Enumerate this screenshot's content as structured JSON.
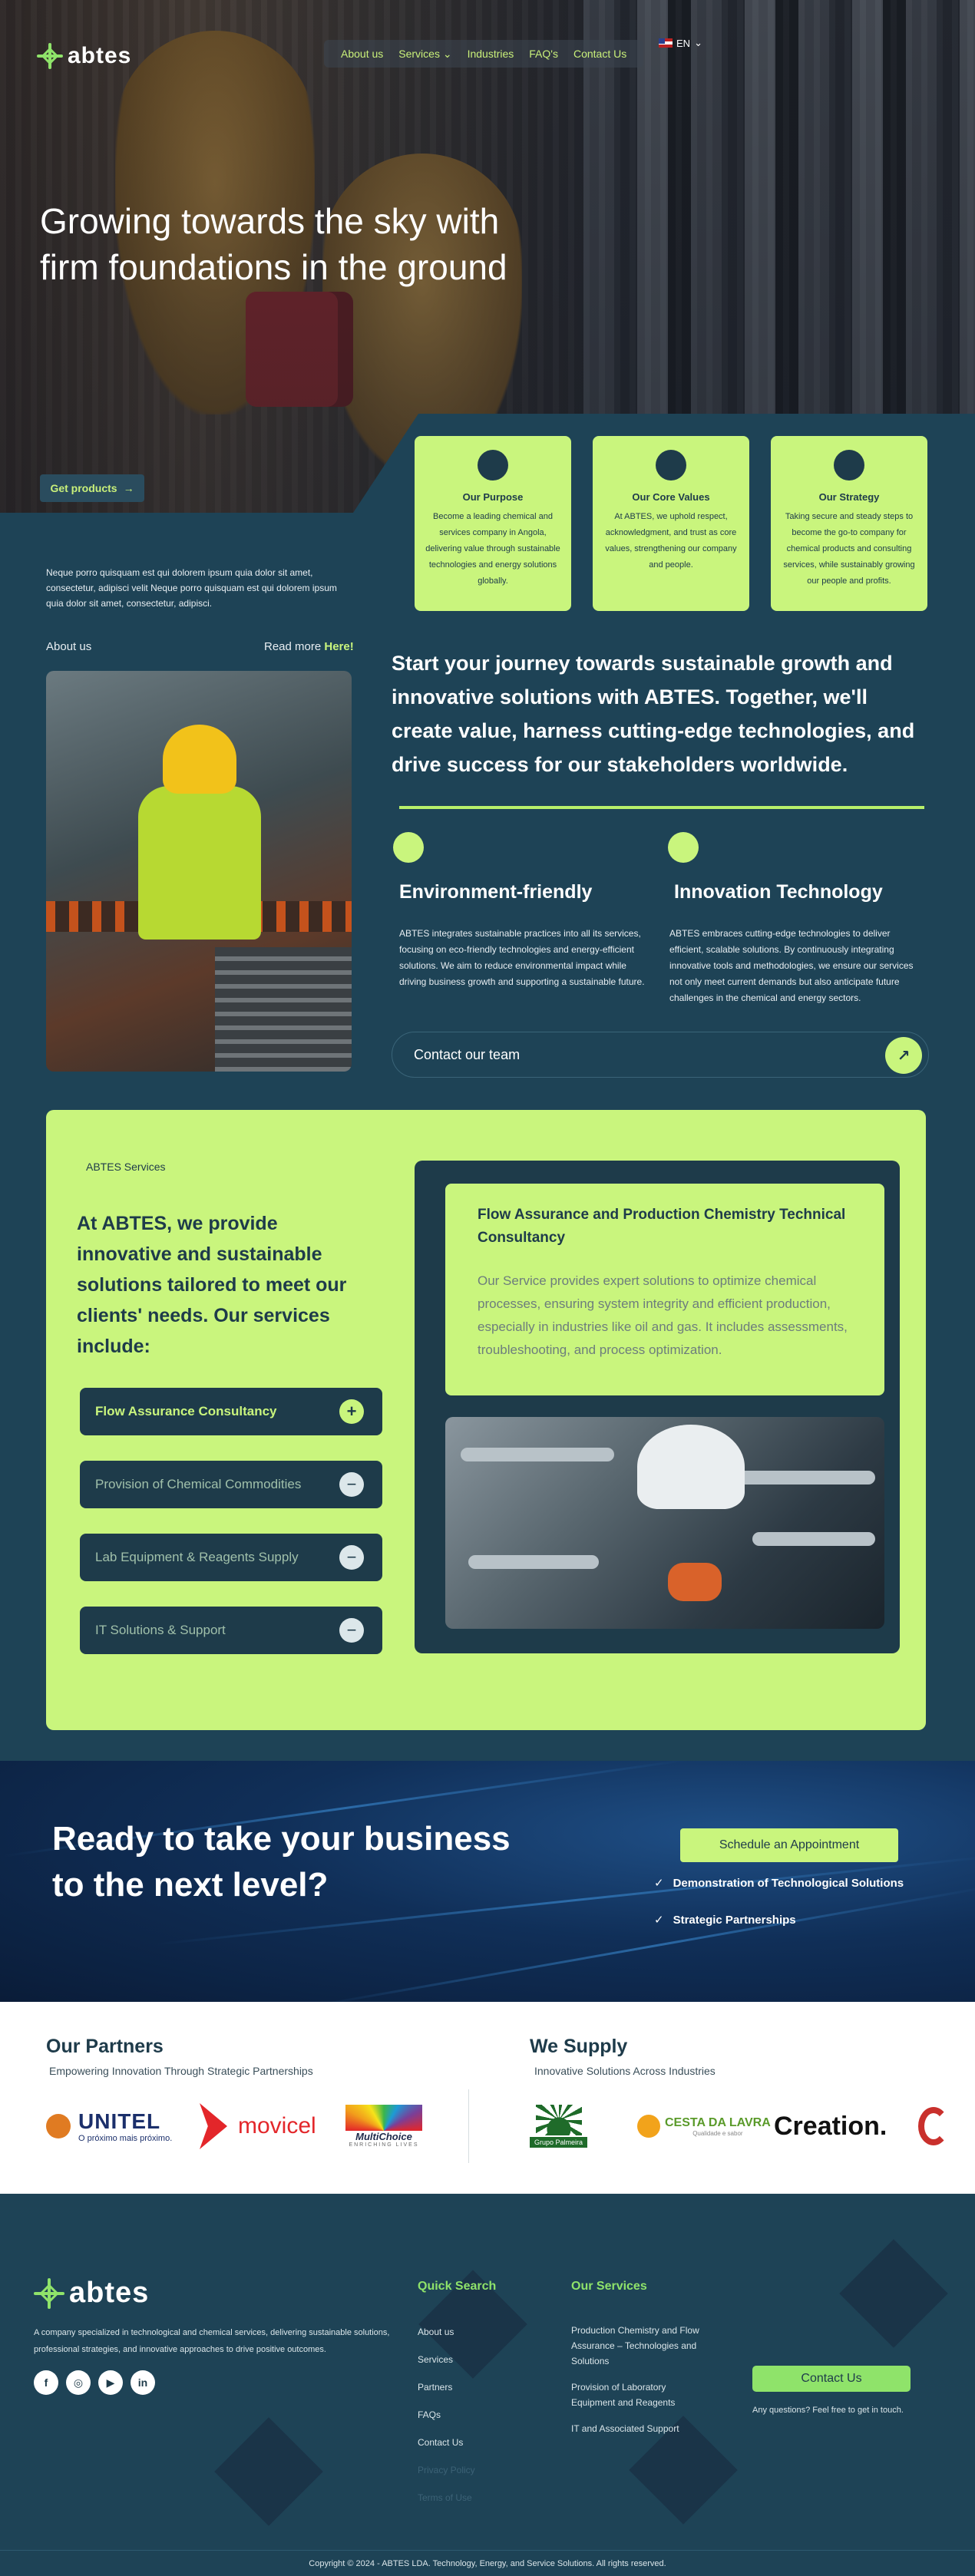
{
  "brand": {
    "name": "abtes",
    "accent": "#c9f57d",
    "dark": "#1e4356"
  },
  "nav": {
    "items": [
      "About us",
      "Services",
      "Industries",
      "FAQ's",
      "Contact Us"
    ],
    "services_chevron": "chevron-down-icon",
    "language": "EN"
  },
  "hero": {
    "title": "Growing towards the sky with firm foundations in the ground",
    "cta": "Get products"
  },
  "cards": [
    {
      "title": "Our Purpose",
      "text": "Become a leading chemical and services company in Angola, delivering value through sustainable technologies and energy solutions globally."
    },
    {
      "title": "Our Core Values",
      "text": "At ABTES, we uphold respect, acknowledgment, and trust as core values, strengthening our company and people."
    },
    {
      "title": "Our Strategy",
      "text": "Taking secure and steady steps to become the go-to company for chemical products and consulting services, while sustainably growing our people and profits."
    }
  ],
  "intro": {
    "text": "Neque porro quisquam est qui dolorem ipsum quia dolor sit amet, consectetur, adipisci velit Neque porro quisquam est qui dolorem ipsum quia dolor sit amet, consectetur, adipisci."
  },
  "about": {
    "label": "About us",
    "read_more": "Read more",
    "read_more_link": "Here!"
  },
  "lead": {
    "text": "Start your journey towards sustainable growth and innovative solutions with ABTES. Together, we'll create value, harness cutting-edge technologies, and drive success for our stakeholders worldwide."
  },
  "features": [
    {
      "title": "Environment-friendly",
      "text": "ABTES integrates sustainable practices into all its services, focusing on eco-friendly technologies and energy-efficient solutions. We aim to reduce environmental impact while driving business growth and supporting a sustainable future."
    },
    {
      "title": "Innovation Technology",
      "text": "ABTES embraces cutting-edge technologies to deliver efficient, scalable solutions. By continuously integrating innovative tools and methodologies, we ensure our services not only meet current demands but also anticipate future challenges in the chemical and energy sectors."
    }
  ],
  "contact_team": "Contact our team",
  "services": {
    "label": "ABTES Services",
    "title": "At ABTES, we provide innovative and sustainable solutions tailored to meet our clients' needs. Our services include:",
    "items": [
      {
        "label": "Flow Assurance Consultancy",
        "icon": "+"
      },
      {
        "label": "Provision of Chemical Commodities",
        "icon": "−"
      },
      {
        "label": "Lab Equipment & Reagents Supply",
        "icon": "−"
      },
      {
        "label": "IT Solutions & Support",
        "icon": "−"
      }
    ],
    "detail_title": "Flow Assurance and Production Chemistry Technical Consultancy",
    "detail_text": "Our Service provides expert solutions to optimize chemical processes, ensuring system integrity and efficient production, especially in industries like oil and gas. It includes assessments, troubleshooting, and process optimization."
  },
  "cta": {
    "title": "Ready to take your business to the next level?",
    "button": "Schedule an Appointment",
    "checks": [
      "Demonstration of Technological Solutions",
      "Strategic Partnerships"
    ]
  },
  "partners": {
    "title": "Our Partners",
    "subtitle": "Empowering Innovation Through Strategic Partnerships",
    "logos": {
      "unitel": "UNITEL",
      "unitel_tag": "O próximo mais próximo.",
      "movicel": "movicel",
      "multichoice": "MultiChoice",
      "multichoice_tag": "ENRICHING LIVES"
    }
  },
  "supply": {
    "title": "We Supply",
    "subtitle": "Innovative Solutions Across Industries",
    "logos": {
      "palmeira": "Grupo Palmeira",
      "cesta": "CESTA DA LAVRA",
      "cesta_tag": "Qualidade e sabor",
      "creation": "Creation."
    }
  },
  "footer": {
    "description": "A company specialized in technological and chemical services, delivering sustainable solutions, professional strategies, and innovative approaches to drive positive outcomes.",
    "social": [
      "facebook-icon",
      "instagram-icon",
      "youtube-icon",
      "linkedin-icon"
    ],
    "quick_title": "Quick Search",
    "quick_links": [
      "About us",
      "Services",
      "Partners",
      "FAQs",
      "Contact Us",
      "Privacy Policy",
      "Terms of Use"
    ],
    "services_title": "Our Services",
    "service_links": [
      "Production Chemistry and Flow Assurance – Technologies and Solutions",
      "Provision of Laboratory Equipment and Reagents",
      "IT and Associated Support"
    ],
    "contact_button": "Contact Us",
    "contact_note": "Any questions? Feel free to get in touch.",
    "copyright": "Copyright © 2024 - ABTES LDA. Technology, Energy, and Service Solutions. All rights reserved."
  }
}
